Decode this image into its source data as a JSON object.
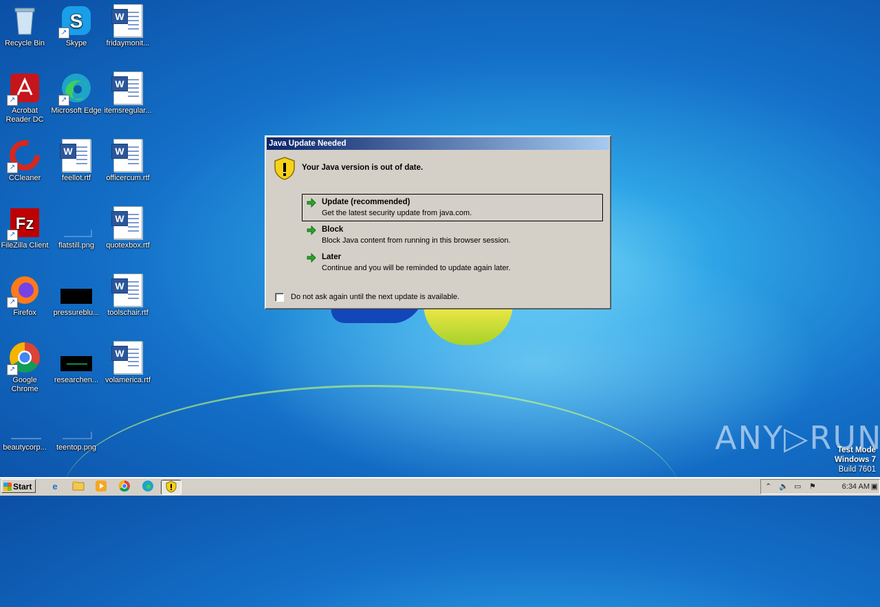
{
  "desktop": {
    "icons": [
      {
        "label": "Recycle Bin",
        "icon": "recycle-bin-icon"
      },
      {
        "label": "Skype",
        "icon": "skype-icon"
      },
      {
        "label": "fridaymonit...",
        "icon": "word-document-icon"
      },
      {
        "label": "Acrobat Reader DC",
        "icon": "acrobat-icon"
      },
      {
        "label": "Microsoft Edge",
        "icon": "edge-icon"
      },
      {
        "label": "itemsregular...",
        "icon": "word-document-icon"
      },
      {
        "label": "CCleaner",
        "icon": "ccleaner-icon"
      },
      {
        "label": "feellot.rtf",
        "icon": "word-document-icon"
      },
      {
        "label": "officercum.rtf",
        "icon": "word-document-icon"
      },
      {
        "label": "FileZilla Client",
        "icon": "filezilla-icon"
      },
      {
        "label": "flatstill.png",
        "icon": "image-file-icon"
      },
      {
        "label": "quotexbox.rtf",
        "icon": "word-document-icon"
      },
      {
        "label": "Firefox",
        "icon": "firefox-icon"
      },
      {
        "label": "pressureblu...",
        "icon": "image-file-icon"
      },
      {
        "label": "toolschair.rtf",
        "icon": "word-document-icon"
      },
      {
        "label": "Google Chrome",
        "icon": "chrome-icon"
      },
      {
        "label": "researchen...",
        "icon": "image-file-icon"
      },
      {
        "label": "volamerica.rtf",
        "icon": "word-document-icon"
      },
      {
        "label": "beautycorp...",
        "icon": "image-file-icon"
      },
      {
        "label": "teentop.png",
        "icon": "image-file-icon"
      }
    ]
  },
  "dialog": {
    "title": "Java Update Needed",
    "headline": "Your Java version is out of date.",
    "options": [
      {
        "title": "Update (recommended)",
        "desc": "Get the latest security update from java.com."
      },
      {
        "title": "Block",
        "desc": "Block Java content from running in this browser session."
      },
      {
        "title": "Later",
        "desc": "Continue and you will be reminded to update again later."
      }
    ],
    "checkbox_label": "Do not ask again until the next update is available."
  },
  "watermark": {
    "text": "ANY▷RUN",
    "test_mode": "Test Mode",
    "os": "Windows 7",
    "build": "Build 7601"
  },
  "taskbar": {
    "start_label": "Start",
    "pinned": [
      "ie-icon",
      "explorer-icon",
      "media-player-icon",
      "chrome-icon",
      "edge-icon",
      "java-warning-icon"
    ],
    "clock": "6:34 AM"
  }
}
